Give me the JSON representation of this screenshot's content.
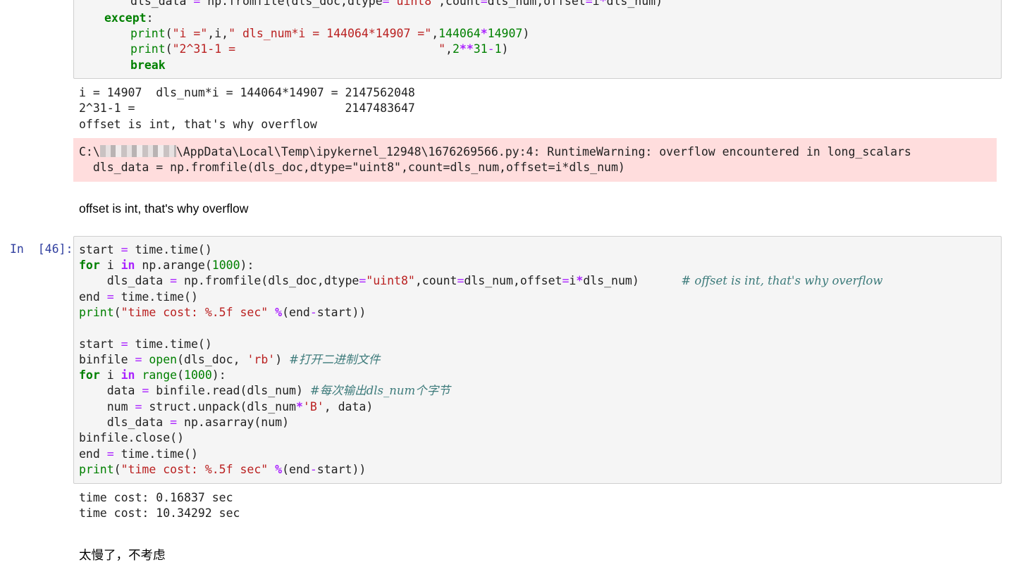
{
  "cell_top": {
    "lines": [
      [
        "        dls_data ",
        "= ",
        "np.fromfile(dls_doc,dtype",
        "=",
        "'uint8'",
        ",count",
        "=",
        "dls_num,offset",
        "=",
        "i",
        "*",
        "dls_num)"
      ],
      [
        "except"
      ],
      [
        "print",
        "(",
        "\"i =\"",
        ",i,",
        "\" dls_num*i = 144064*14907 =\"",
        ",",
        "144064",
        "*",
        "14907",
        ")"
      ],
      [
        "print",
        "(",
        "\"2^31-1 =                              \"",
        ",",
        "2",
        "**",
        "31",
        "-",
        "1",
        ")"
      ],
      [
        "break"
      ]
    ]
  },
  "output_top": {
    "line1": "i = 14907  dls_num*i = 144064*14907 = 2147562048",
    "line2": "2^31-1 =                              2147483647",
    "line3": "offset is int, that's why overflow"
  },
  "stderr": {
    "prefix": "C:\\",
    "suffix": "\\AppData\\Local\\Temp\\ipykernel_12948\\1676269566.py:4: RuntimeWarning: overflow encountered in long_scalars",
    "line2": "  dls_data = np.fromfile(dls_doc,dtype=\"uint8\",count=dls_num,offset=i*dls_num)"
  },
  "markdown1": "offset is int, that's why overflow",
  "cell46": {
    "prompt": "In  [46]:",
    "comment1": "# offset is int, that's why overflow",
    "comment2": "#打开二进制文件",
    "comment3": "#每次输出dls_num个字节"
  },
  "output46": {
    "line1": "time cost: 0.16837 sec",
    "line2": "time cost: 10.34292 sec"
  },
  "markdown2": "太慢了，不考虑"
}
